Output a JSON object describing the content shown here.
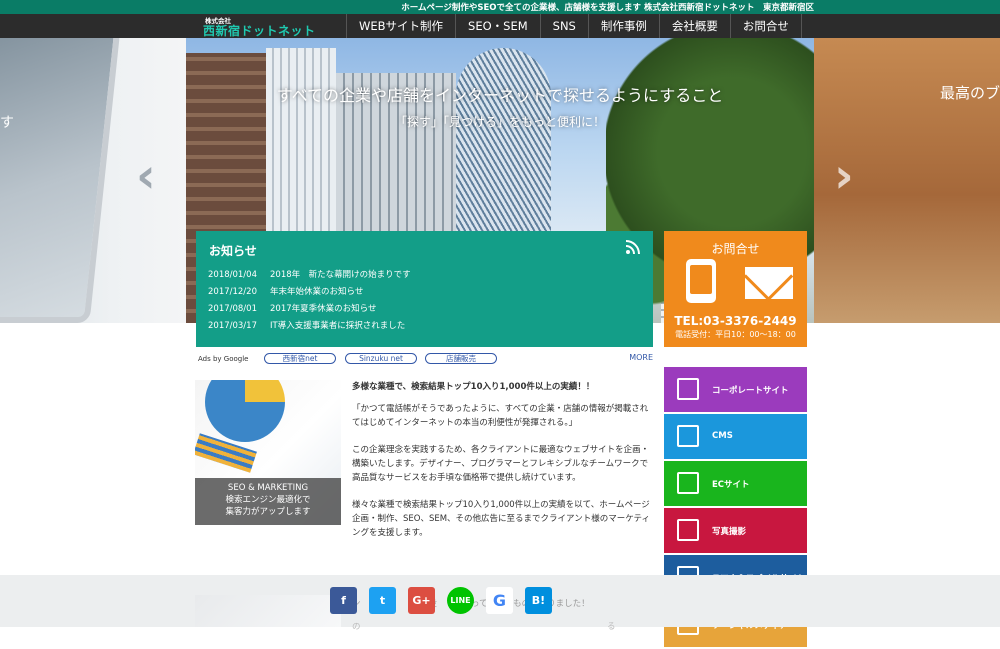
{
  "topbar": {
    "tagline": "ホームページ制作やSEOで全ての企業様、店舗様を支援します 株式会社西新宿ドットネット　東京都新宿区"
  },
  "logo": {
    "small": "株式会社",
    "big": "西新宿ドットネット"
  },
  "nav": {
    "items": [
      "WEBサイト制作",
      "SEO・SEM",
      "SNS",
      "制作事例",
      "会社概要",
      "お問合せ"
    ]
  },
  "hero": {
    "headline": "すべての企業や店舗をインターネットで探せるようにすること",
    "sub": "「探す」「見つける」をもっと便利に！",
    "left_partial": "す",
    "right_partial": "最高のブ"
  },
  "news": {
    "title": "お知らせ",
    "items": [
      {
        "date": "2018/01/04",
        "text": "2018年　新たな幕開けの始まりです"
      },
      {
        "date": "2017/12/20",
        "text": "年末年始休業のお知らせ"
      },
      {
        "date": "2017/08/01",
        "text": "2017年夏季休業のお知らせ"
      },
      {
        "date": "2017/03/17",
        "text": "IT導入支援事業者に採択されました"
      }
    ]
  },
  "contact": {
    "title": "お問合せ",
    "tel": "TEL:03-3376-2449",
    "hours": "電話受付：平日10：00～18：00"
  },
  "ads": {
    "label": "Ads by Google",
    "chips": [
      "西新宿net",
      "Sinzuku net",
      "店舗販売"
    ],
    "more": "MORE"
  },
  "feature": {
    "line1": "SEO & MARKETING",
    "line2": "検索エンジン最適化で",
    "line3": "集客力がアップします"
  },
  "article": {
    "heading": "多様な業種で、検索結果トップ10入り1,000件以上の実績！！",
    "p1": "「かつて電話帳がそうであったように、すべての企業・店舗の情報が掲載されてはじめてインターネットの本当の利便性が発揮される。」",
    "p2": "この企業理念を実践するため、各クライアントに最適なウェブサイトを企画・構築いたします。デザイナー、プログラマーとフレキシブルなチームワークで高品質なサービスをお手頃な価格帯で提供し続けています。",
    "p3": "様々な業種で検索結果トップ10入り1,000件以上の実績を以て、ホームページ企画・制作、SEO、SEM、その他広告に至るまでクライアント様のマーケティングを支援します。"
  },
  "services": [
    {
      "label": "コーポレートサイト",
      "color": "#9b3bbd",
      "icon": "monitor-icon"
    },
    {
      "label": "CMS",
      "color": "#1b97dc",
      "icon": "document-icon"
    },
    {
      "label": "ECサイト",
      "color": "#19b51d",
      "icon": "cart-icon"
    },
    {
      "label": "写真撮影",
      "color": "#c8173f",
      "icon": "camera-icon"
    },
    {
      "label": "スマホ＆モバイルサイト",
      "color": "#1d5d9e",
      "icon": "image-icon"
    },
    {
      "label": "ソーシャルメディア",
      "color": "#e7a43a",
      "icon": "chat-icon"
    }
  ],
  "footer": {
    "text": "ン　ッ　　　　　　役　　になって　な　ものになりました！",
    "text2": "の　　　　　　　　　　　　　　　　　　　　　　　　　　　　　る"
  },
  "share": [
    {
      "name": "facebook",
      "glyph": "f",
      "color": "#3b5998"
    },
    {
      "name": "twitter",
      "glyph": "t",
      "color": "#1da1f2"
    },
    {
      "name": "googleplus",
      "glyph": "G+",
      "color": "#dc4e41"
    },
    {
      "name": "line",
      "glyph": "LINE",
      "color": "#00c300"
    },
    {
      "name": "google",
      "glyph": "G",
      "color": "#ffffff"
    },
    {
      "name": "hatena",
      "glyph": "B!",
      "color": "#008fde"
    }
  ]
}
